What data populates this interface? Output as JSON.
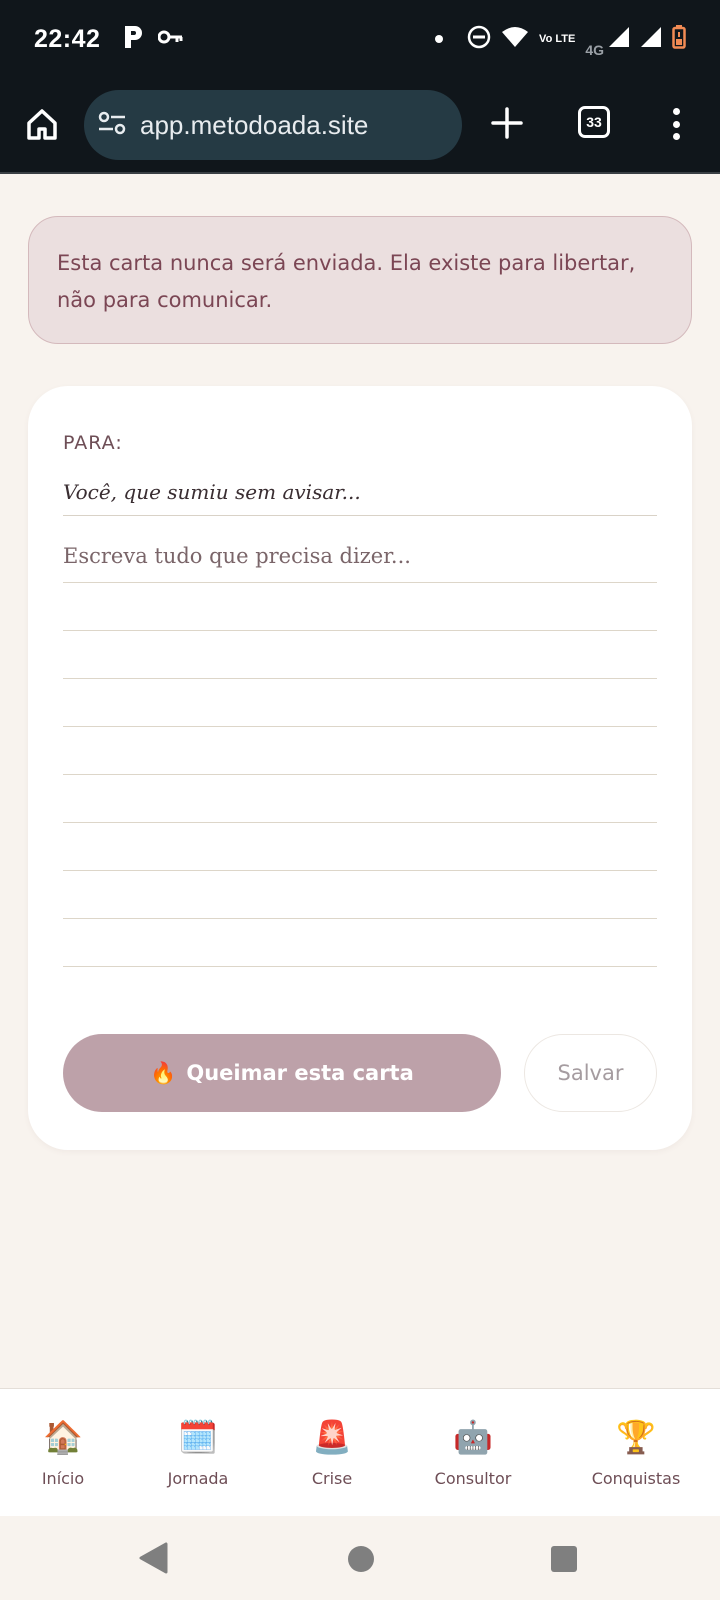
{
  "status_bar": {
    "time": "22:42",
    "network": "4G",
    "volte": "Vo LTE",
    "icons": [
      "p-app-icon",
      "key-icon",
      "notification-dot",
      "dnd-icon",
      "wifi-icon",
      "volte-icon",
      "signal-icon",
      "signal-icon",
      "battery-low-icon"
    ]
  },
  "browser": {
    "url": "app.metodoada.site",
    "tab_count": "33",
    "icons": [
      "home-icon",
      "site-settings-icon",
      "plus-icon",
      "tabs-icon",
      "more-icon"
    ]
  },
  "note": {
    "text": "Esta carta nunca será enviada. Ela existe para libertar, não para comunicar."
  },
  "letter": {
    "to_label": "PARA:",
    "to_placeholder": "Você, que sumiu sem avisar...",
    "body_placeholder": "Escreva tudo que precisa dizer...",
    "burn_icon": "🔥",
    "burn_label": "Queimar esta carta",
    "save_label": "Salvar"
  },
  "bottom_nav": {
    "items": [
      {
        "icon": "🏠",
        "label": "Início"
      },
      {
        "icon": "🗓️",
        "label": "Jornada"
      },
      {
        "icon": "🚨",
        "label": "Crise"
      },
      {
        "icon": "🤖",
        "label": "Consultor"
      },
      {
        "icon": "🏆",
        "label": "Conquistas"
      }
    ]
  },
  "colors": {
    "page_background": "#f8f3ee",
    "note_background": "#ebdfdf",
    "note_text": "#7b4654",
    "burn_button": "#bda1a9",
    "status_bar": "#10161b",
    "url_pill": "#253a44"
  }
}
